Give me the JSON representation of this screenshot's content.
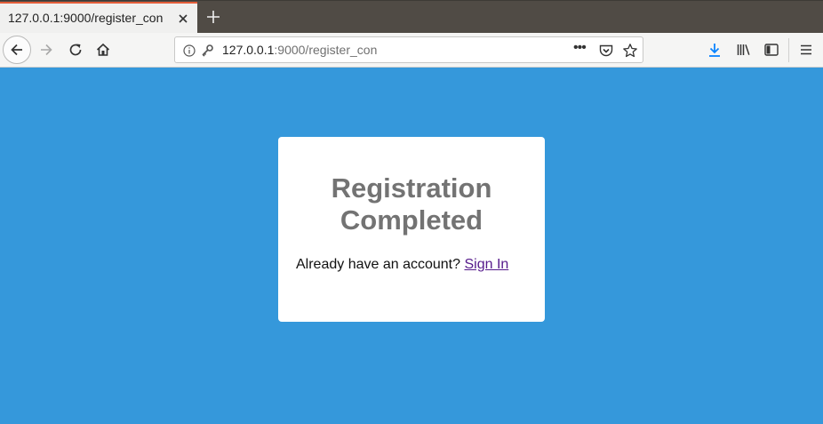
{
  "browser": {
    "tab_title": "127.0.0.1:9000/register_con",
    "url": {
      "host": "127.0.0.1",
      "rest": ":9000/register_con"
    },
    "page_actions": "•••",
    "accent_color": "#e35d39",
    "download_color": "#0a84ff"
  },
  "page": {
    "background": "#3598db",
    "title_line1": "Registration",
    "title_line2": "Completed",
    "prompt_text": "Already have an account?",
    "signin_link": "Sign In"
  }
}
